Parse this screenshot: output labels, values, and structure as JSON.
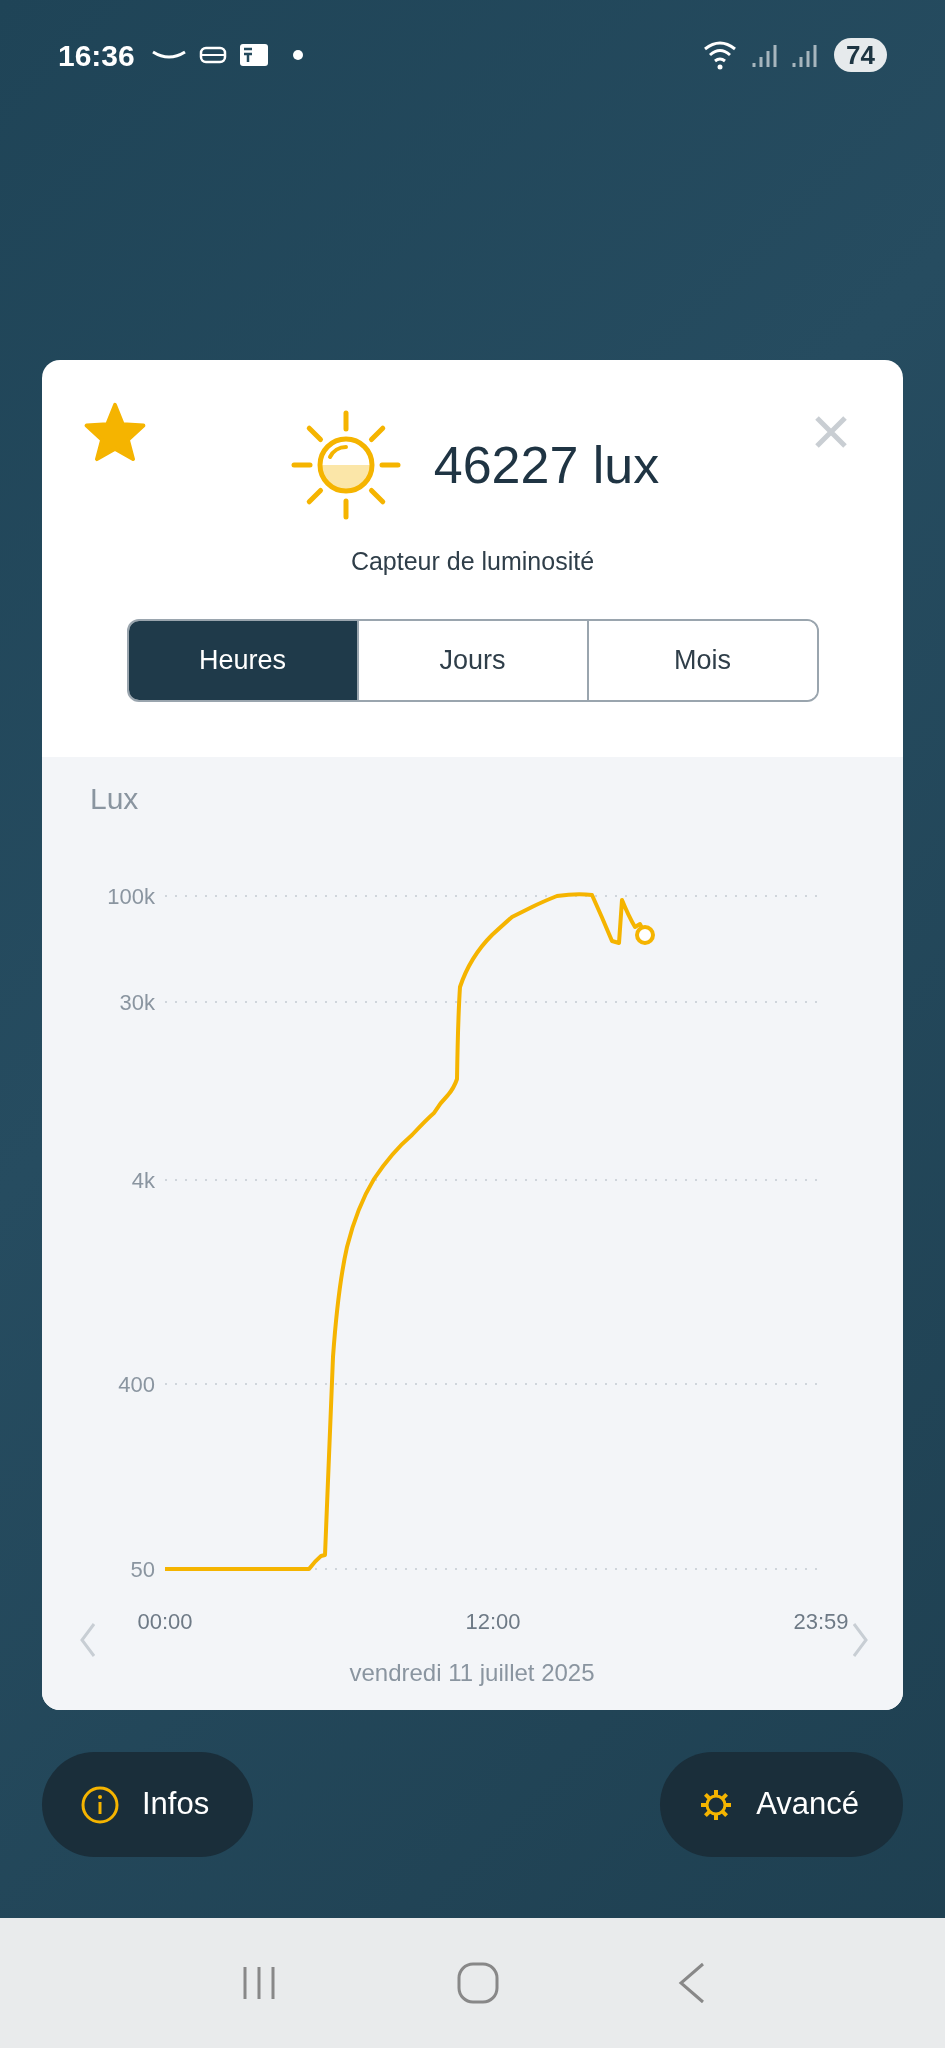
{
  "status_bar": {
    "time": "16:36",
    "battery": "74"
  },
  "sensor": {
    "favorite": true,
    "value": "46227 lux",
    "name": "Capteur de luminosité"
  },
  "tabs": [
    {
      "label": "Heures",
      "selected": true
    },
    {
      "label": "Jours",
      "selected": false
    },
    {
      "label": "Mois",
      "selected": false
    }
  ],
  "chart": {
    "axis_title": "Lux",
    "y_labels": [
      "100k",
      "30k",
      "4k",
      "400",
      "50"
    ],
    "x_labels": [
      "00:00",
      "12:00",
      "23:59"
    ],
    "date": "vendredi 11 juillet 2025"
  },
  "buttons": [
    {
      "label": "Infos",
      "kind": "info"
    },
    {
      "label": "Avancé",
      "kind": "settings"
    }
  ]
}
